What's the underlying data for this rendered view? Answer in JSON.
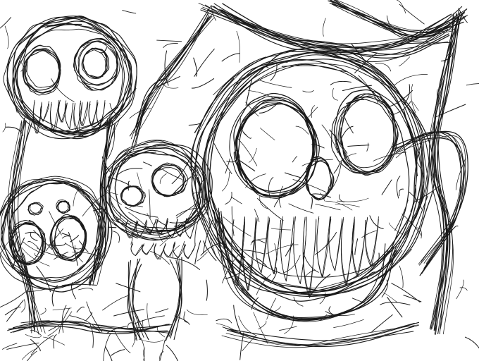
{
  "artwork": {
    "background_color": "#ffffff",
    "ink_color": "#1a1a1a",
    "style": "scribbled pen sketch",
    "subjects": [
      "tall-skull-creature-left",
      "small-skull-center",
      "large-skull-right",
      "tendrils-background"
    ]
  }
}
